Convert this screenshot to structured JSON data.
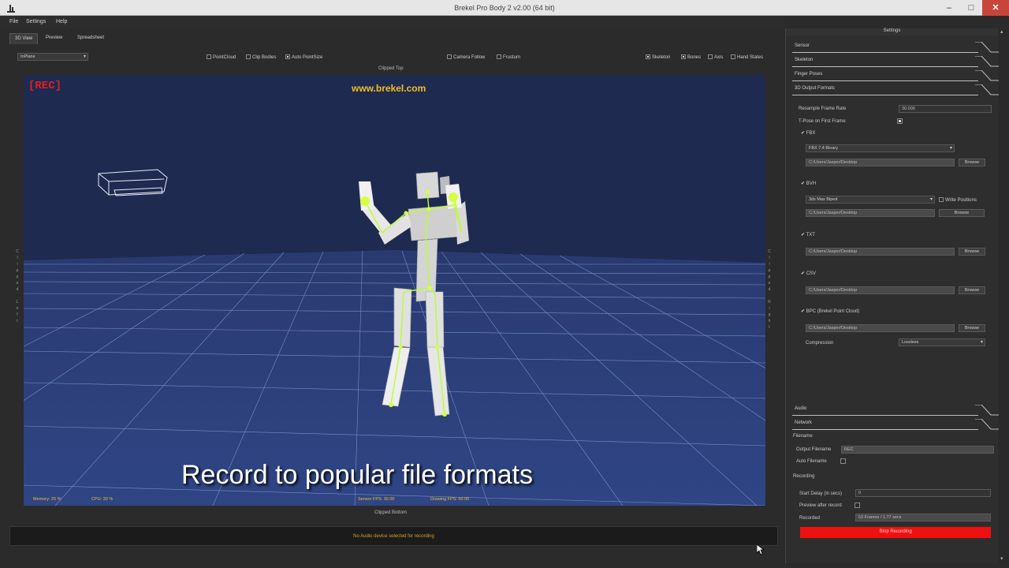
{
  "window": {
    "title": "Brekel Pro Body 2 v2.00 (64 bit)"
  },
  "menu": [
    "File",
    "Settings",
    "Help"
  ],
  "view_tabs": [
    "3D View",
    "Preview",
    "Spreadsheet"
  ],
  "toolbar": {
    "view_select": "InPlane",
    "options": [
      {
        "label": "PointCloud",
        "checked": false
      },
      {
        "label": "Clip Bodies",
        "checked": false
      },
      {
        "label": "Auto PointSize",
        "checked": true
      },
      {
        "label": "Camera Follow",
        "checked": false
      },
      {
        "label": "Frustum",
        "checked": false
      },
      {
        "label": "Skeleton",
        "checked": true
      },
      {
        "label": "Bones",
        "checked": true
      },
      {
        "label": "Axis",
        "checked": false
      },
      {
        "label": "Hand States",
        "checked": false
      }
    ]
  },
  "viewport": {
    "clipped_top": "Clipped Top",
    "clipped_bottom": "Clipped Bottom",
    "rec": "[REC]",
    "brand": "www.brekel.com",
    "caption": "Record to popular file formats",
    "memory": "Memory: 25 %",
    "cpu": "CPU: 30 %",
    "sensor_fps": "Sensor FPS: 30.00",
    "drawing_fps": "Drawing FPS: 60.00",
    "left_ruler": "Clipped Left",
    "right_ruler": "Clipped Right"
  },
  "status_message": "No Audio device selected for recording",
  "settings": {
    "title": "Settings",
    "sections_top": [
      "Sensor",
      "Skeleton",
      "Finger Poses",
      "3D Output Formats"
    ],
    "resample_label": "Resample Frame Rate",
    "resample_value": "30.000",
    "tpose_label": "T-Pose on First Frame",
    "formats": [
      {
        "name": "FBX",
        "select": "FBX 7.4 Binary",
        "path": "C:/Users/Jasper/Desktop",
        "browse": "Browse"
      },
      {
        "name": "BVH",
        "select": "3ds Max Biped",
        "write_positions": "Write Positions",
        "path": "C:/Users/Jasper/Desktop",
        "browse": "Browse"
      },
      {
        "name": "TXT",
        "path": "C:/Users/Jasper/Desktop",
        "browse": "Browse"
      },
      {
        "name": "CSV",
        "path": "C:/Users/Jasper/Desktop",
        "browse": "Browse"
      },
      {
        "name": "BPC (Brekel Point Cloud)",
        "path": "C:/Users/Jasper/Desktop",
        "browse": "Browse"
      }
    ],
    "compression_label": "Compression",
    "compression_value": "Lossless",
    "sections_bottom": [
      "Audio",
      "Network"
    ],
    "filename_header": "Filename",
    "output_filename_label": "Output Filename",
    "output_filename_value": "REC",
    "auto_filename_label": "Auto Filename",
    "recording_header": "Recording",
    "start_delay_label": "Start Delay (in secs)",
    "start_delay_value": "0",
    "preview_label": "Preview after record",
    "recorded_label": "Recorded",
    "recorded_value": "53 Frames / 1.77 secs",
    "stop_button": "Stop Recording"
  },
  "colors": {
    "viewport_bg": "#1e2a50",
    "rec": "#e02020",
    "brand": "#f0c020",
    "record_button": "#f01010",
    "status_text": "#e0a020"
  }
}
